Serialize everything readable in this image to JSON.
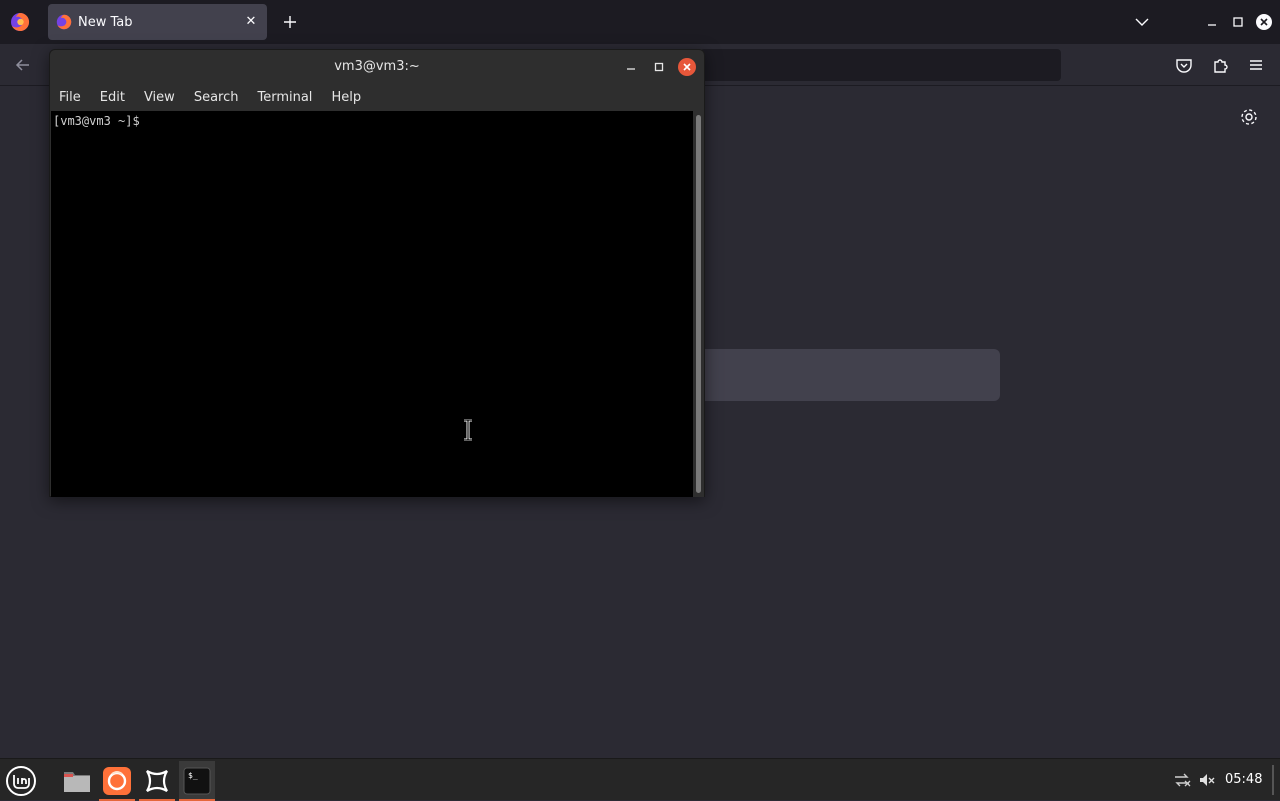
{
  "firefox": {
    "tab": {
      "title": "New Tab"
    },
    "newtab_icon": "plus-icon",
    "brand_fragment": "fox"
  },
  "terminal": {
    "title": "vm3@vm3:~",
    "menu": [
      "File",
      "Edit",
      "View",
      "Search",
      "Terminal",
      "Help"
    ],
    "prompt": "[vm3@vm3 ~]$"
  },
  "taskbar": {
    "launchers": [
      "files-icon",
      "firefox-icon",
      "window-manager-icon",
      "terminal-icon"
    ],
    "clock": "05:48",
    "accent": "#e5673c"
  },
  "colors": {
    "firefox_bg": "#2b2a33",
    "terminal_close": "#e7573a"
  }
}
